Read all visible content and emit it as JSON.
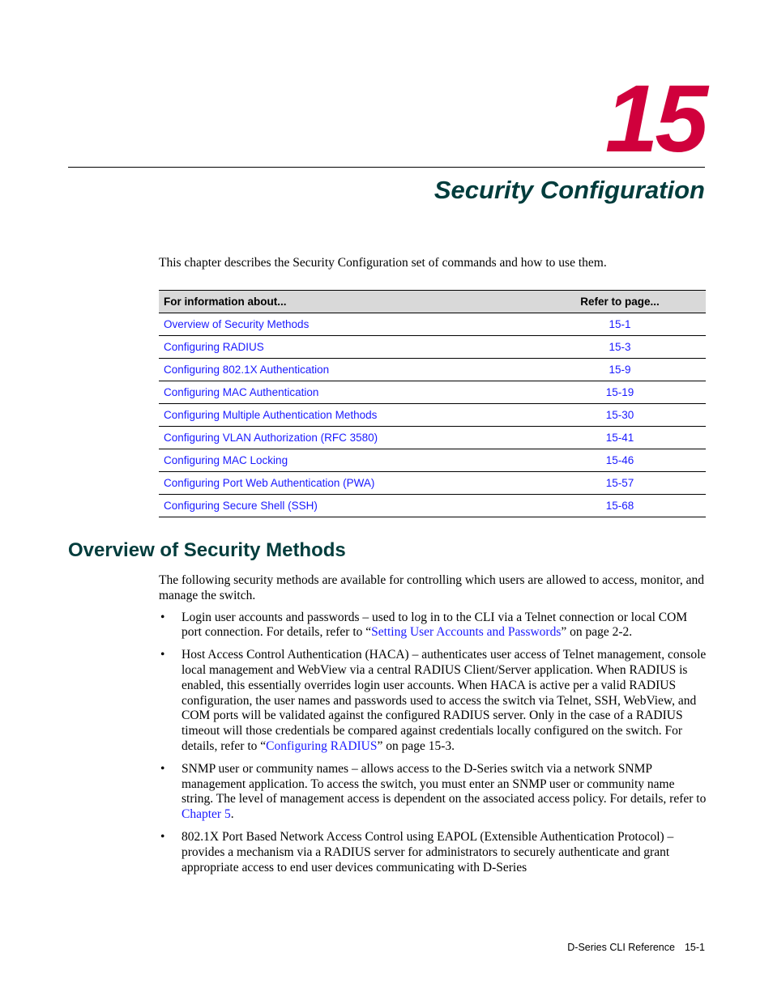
{
  "chapter": {
    "number": "15",
    "title": "Security Configuration",
    "intro": "This chapter describes the Security Configuration set of commands and how to use them."
  },
  "toc": {
    "headers": {
      "topic": "For information about...",
      "page": "Refer to page..."
    },
    "rows": [
      {
        "topic": "Overview of Security Methods",
        "page": "15-1"
      },
      {
        "topic": "Configuring RADIUS",
        "page": "15-3"
      },
      {
        "topic": "Configuring 802.1X Authentication",
        "page": "15-9"
      },
      {
        "topic": "Configuring MAC Authentication",
        "page": "15-19"
      },
      {
        "topic": "Configuring Multiple Authentication Methods",
        "page": "15-30"
      },
      {
        "topic": "Configuring VLAN Authorization (RFC 3580)",
        "page": "15-41"
      },
      {
        "topic": "Configuring MAC Locking",
        "page": "15-46"
      },
      {
        "topic": "Configuring Port Web Authentication (PWA)",
        "page": "15-57"
      },
      {
        "topic": "Configuring Secure Shell (SSH)",
        "page": "15-68"
      }
    ]
  },
  "section": {
    "title": "Overview of Security Methods",
    "intro": "The following security methods are available for controlling which users are allowed to access, monitor, and manage the switch.",
    "bullet_symbol": "•",
    "bullets": [
      {
        "before": "Login user accounts and passwords – used to log in to the CLI via a Telnet connection or local COM port connection. For details, refer to “",
        "link": "Setting User Accounts and Passwords",
        "after": "” on page 2-2."
      },
      {
        "before": "Host Access Control Authentication (HACA) – authenticates user access of Telnet management, console local management and WebView via a central RADIUS Client/Server application. When RADIUS is enabled, this essentially overrides login user accounts. When HACA is active per a valid RADIUS configuration, the user names and passwords used to access the switch via Telnet, SSH, WebView, and COM ports will be validated against the configured RADIUS server. Only in the case of a RADIUS timeout will those credentials be compared against credentials locally configured on the switch. For details, refer to “",
        "link": "Configuring RADIUS",
        "after": "” on page 15-3."
      },
      {
        "before": "SNMP user or community names – allows access to the D-Series switch via a network SNMP management application. To access the switch, you must enter an SNMP user or community name string. The level of management access is dependent on the associated access policy. For details, refer to ",
        "link": "Chapter 5",
        "after": "."
      },
      {
        "before": "802.1X Port Based Network Access Control using EAPOL (Extensible Authentication Protocol) – provides a mechanism via a RADIUS server for administrators to securely authenticate and grant appropriate access to end user devices communicating with D-Series",
        "link": "",
        "after": ""
      }
    ]
  },
  "footer": {
    "book": "D-Series CLI Reference",
    "page": "15-1"
  },
  "colors": {
    "chapter_number": "#d0003c",
    "heading": "#003c3c",
    "link": "#1a1aff",
    "table_header_bg": "#d9d9d9"
  }
}
